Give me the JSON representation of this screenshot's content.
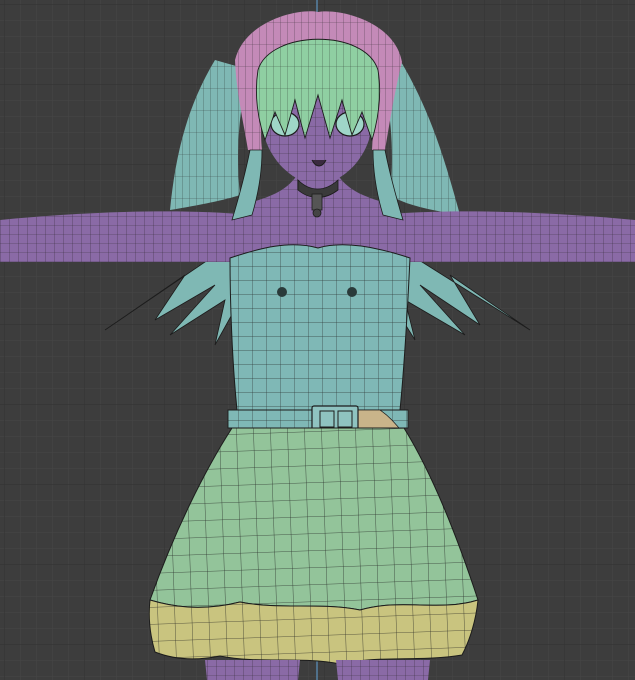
{
  "viewport": {
    "background": "#3d3d3d",
    "grid_minor_color": "#474747",
    "grid_major_color": "#353535",
    "axis_color": "#5b8fb8"
  },
  "model": {
    "colors": {
      "skin": "#8a6aa6",
      "skin_dark": "#6e5488",
      "hair_green": "#8fcfa2",
      "hair_teal": "#7fb8b4",
      "hair_pink": "#c48ab8",
      "top_teal": "#7fb8b6",
      "skirt_green": "#93c49a",
      "skirt_yellow": "#c9c47f",
      "belt": "#7fb8b6",
      "belt_strap": "#c9b48a",
      "wire": "#1c1c1c"
    }
  }
}
